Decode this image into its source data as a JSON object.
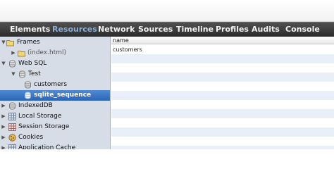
{
  "toolbar": {
    "tabs": [
      {
        "label": "Elements"
      },
      {
        "label": "Resources",
        "selected": true
      },
      {
        "label": "Network"
      },
      {
        "label": "Sources"
      },
      {
        "label": "Timeline"
      },
      {
        "label": "Profiles"
      },
      {
        "label": "Audits"
      },
      {
        "label": "Console"
      }
    ]
  },
  "sidebar": {
    "items": [
      {
        "label": "Frames",
        "icon": "folder-icon",
        "expanded": true
      },
      {
        "label": "(index.html)",
        "icon": "folder-icon",
        "expanded": false,
        "muted": true
      },
      {
        "label": "Web SQL",
        "icon": "database-icon",
        "expanded": true
      },
      {
        "label": "Test",
        "icon": "database-icon",
        "expanded": true
      },
      {
        "label": "customers",
        "icon": "table-icon"
      },
      {
        "label": "sqlite_sequence",
        "icon": "table-icon",
        "selected": true
      },
      {
        "label": "IndexedDB",
        "icon": "database-icon",
        "expanded": false
      },
      {
        "label": "Local Storage",
        "icon": "grid-icon",
        "expanded": false
      },
      {
        "label": "Session Storage",
        "icon": "grid-icon",
        "expanded": false
      },
      {
        "label": "Cookies",
        "icon": "cookie-icon",
        "expanded": false
      },
      {
        "label": "Application Cache",
        "icon": "grid-icon",
        "expanded": false
      }
    ]
  },
  "grid": {
    "column": "name",
    "rows": [
      "customers"
    ]
  },
  "colors": {
    "toolbar_bg": "#3c3c3c",
    "selected_tab": "#8aaed6",
    "sidebar_bg": "#d7dde6",
    "selection": "#2f6bbf",
    "alt_row": "#e9eff8"
  }
}
